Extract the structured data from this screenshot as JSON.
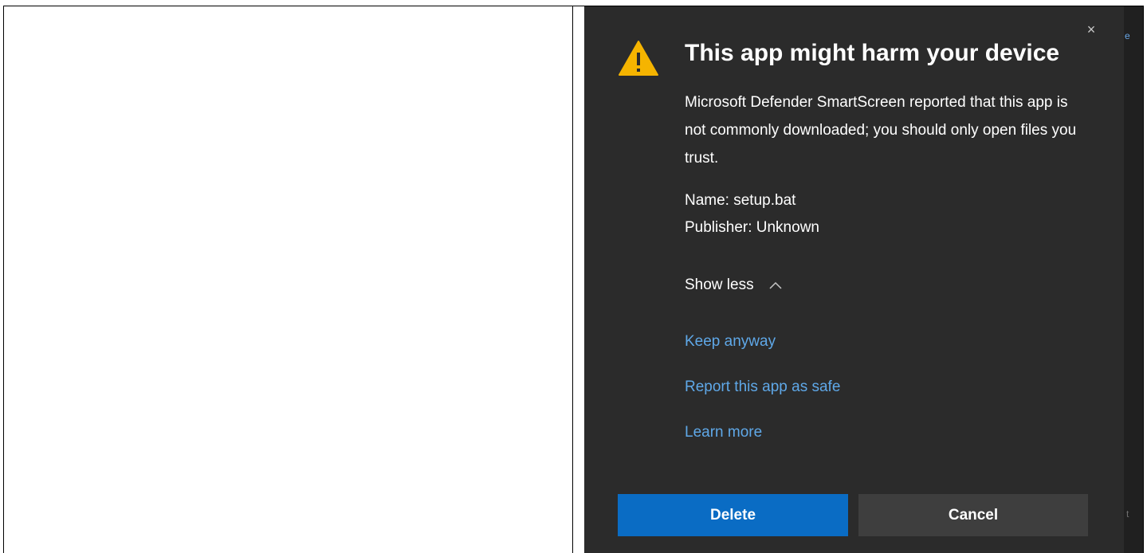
{
  "dialog": {
    "title": "This app might harm your device",
    "description": "Microsoft Defender SmartScreen reported that this app is not commonly downloaded; you should only open files you trust.",
    "name_line": "Name: setup.bat",
    "publisher_line": "Publisher: Unknown",
    "show_less_label": "Show less",
    "links": {
      "keep_anyway": "Keep anyway",
      "report_safe": "Report this app as safe",
      "learn_more": "Learn more"
    },
    "buttons": {
      "delete": "Delete",
      "cancel": "Cancel"
    },
    "close_glyph": "×",
    "icon": "warning-icon",
    "colors": {
      "dialog_bg": "#2b2b2b",
      "link": "#5fa8e8",
      "primary_button": "#0a6cc4",
      "secondary_button": "#3e3e3e",
      "warning": "#f5b400"
    }
  },
  "background": {
    "edge_glyph_top": "e",
    "edge_glyph_bottom": "t"
  }
}
